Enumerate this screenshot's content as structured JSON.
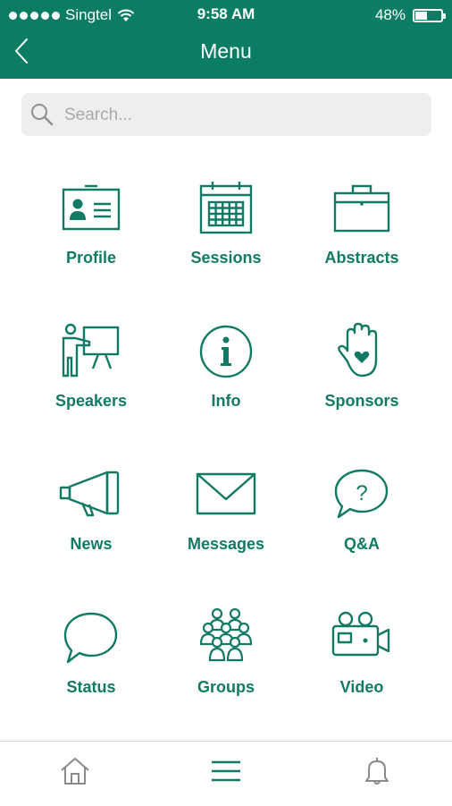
{
  "status_bar": {
    "carrier": "Singtel",
    "time": "9:58 AM",
    "battery": "48%",
    "battery_level": 0.48
  },
  "header": {
    "title": "Menu"
  },
  "search": {
    "placeholder": "Search..."
  },
  "menu": {
    "items": [
      {
        "label": "Profile",
        "icon": "profile-card-icon"
      },
      {
        "label": "Sessions",
        "icon": "calendar-icon"
      },
      {
        "label": "Abstracts",
        "icon": "briefcase-icon"
      },
      {
        "label": "Speakers",
        "icon": "presenter-icon"
      },
      {
        "label": "Info",
        "icon": "info-icon"
      },
      {
        "label": "Sponsors",
        "icon": "hand-heart-icon"
      },
      {
        "label": "News",
        "icon": "megaphone-icon"
      },
      {
        "label": "Messages",
        "icon": "envelope-icon"
      },
      {
        "label": "Q&A",
        "icon": "question-bubble-icon"
      },
      {
        "label": "Status",
        "icon": "speech-bubble-icon"
      },
      {
        "label": "Groups",
        "icon": "group-icon"
      },
      {
        "label": "Video",
        "icon": "video-camera-icon"
      }
    ]
  },
  "tab_bar": {
    "items": [
      {
        "icon": "home-icon"
      },
      {
        "icon": "hamburger-menu-icon"
      },
      {
        "icon": "bell-icon"
      }
    ]
  },
  "colors": {
    "header_bg": "#0b7d64",
    "accent": "#127a64",
    "search_bg": "#eeeeee"
  }
}
